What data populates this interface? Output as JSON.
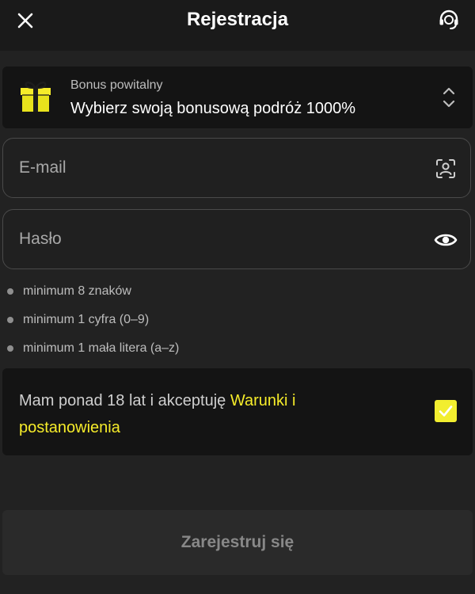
{
  "header": {
    "title": "Rejestracja",
    "close_icon": "close-icon",
    "support_icon": "headset-support-icon"
  },
  "bonus": {
    "label": "Bonus powitalny",
    "value": "Wybierz swoją bonusową podróż 1000%",
    "icon": "gift-icon",
    "accent_color": "#f6ec2a"
  },
  "form": {
    "email": {
      "placeholder": "E-mail",
      "value": "",
      "icon": "contact-lookup-icon"
    },
    "password": {
      "placeholder": "Hasło",
      "value": "",
      "icon": "eye-icon"
    }
  },
  "password_rules": [
    {
      "text": "minimum 8 znaków"
    },
    {
      "text": "minimum 1 cyfra (0–9)"
    },
    {
      "text": "minimum 1 mała litera (a–z)"
    }
  ],
  "terms": {
    "text_before": "Mam ponad 18 lat i akceptuję ",
    "link_text": "Warunki i postanowienia",
    "checked": true,
    "link_color": "#f6ec2a"
  },
  "submit": {
    "label": "Zarejestruj się"
  }
}
